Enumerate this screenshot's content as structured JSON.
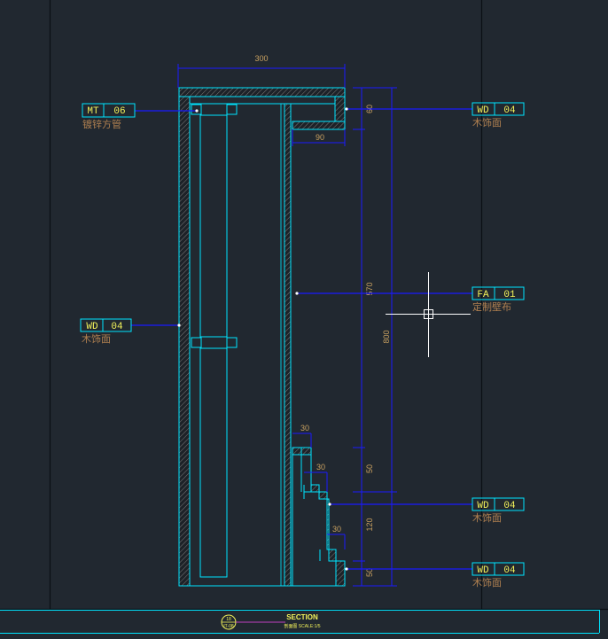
{
  "dimensions": {
    "top_width": "300",
    "top_height": "60",
    "return_width": "90",
    "panel_height": "570",
    "total_height": "800",
    "step1_offset": "30",
    "step2_offset": "30",
    "step3_offset": "30",
    "step1_height": "50",
    "step2_height": "120",
    "base_height": "50"
  },
  "tags": {
    "mt06": {
      "code": "MT",
      "num": "06",
      "note": "镀锌方管"
    },
    "wd04_left": {
      "code": "WD",
      "num": "04",
      "note": "木饰面"
    },
    "wd04_top_right": {
      "code": "WD",
      "num": "04",
      "note": "木饰面"
    },
    "fa01": {
      "code": "FA",
      "num": "01",
      "note": "定制壁布"
    },
    "wd04_mid_right": {
      "code": "WD",
      "num": "04",
      "note": "木饰面"
    },
    "wd04_bottom_right": {
      "code": "WD",
      "num": "04",
      "note": "木饰面"
    }
  },
  "title_block": {
    "circle_top": "18",
    "circle_bottom": "IT-08",
    "title": "SECTION",
    "subtitle": "剖面图  SCALE:1/5"
  },
  "colors": {
    "background": "#212830",
    "outline": "#00e5ff",
    "leader": "#1a1aff",
    "hatch": "#7a7a7a",
    "tag_text": "#f2f25a",
    "note_text": "#b08050",
    "frame": "#0b0f14",
    "title_line": "#c040c0"
  }
}
